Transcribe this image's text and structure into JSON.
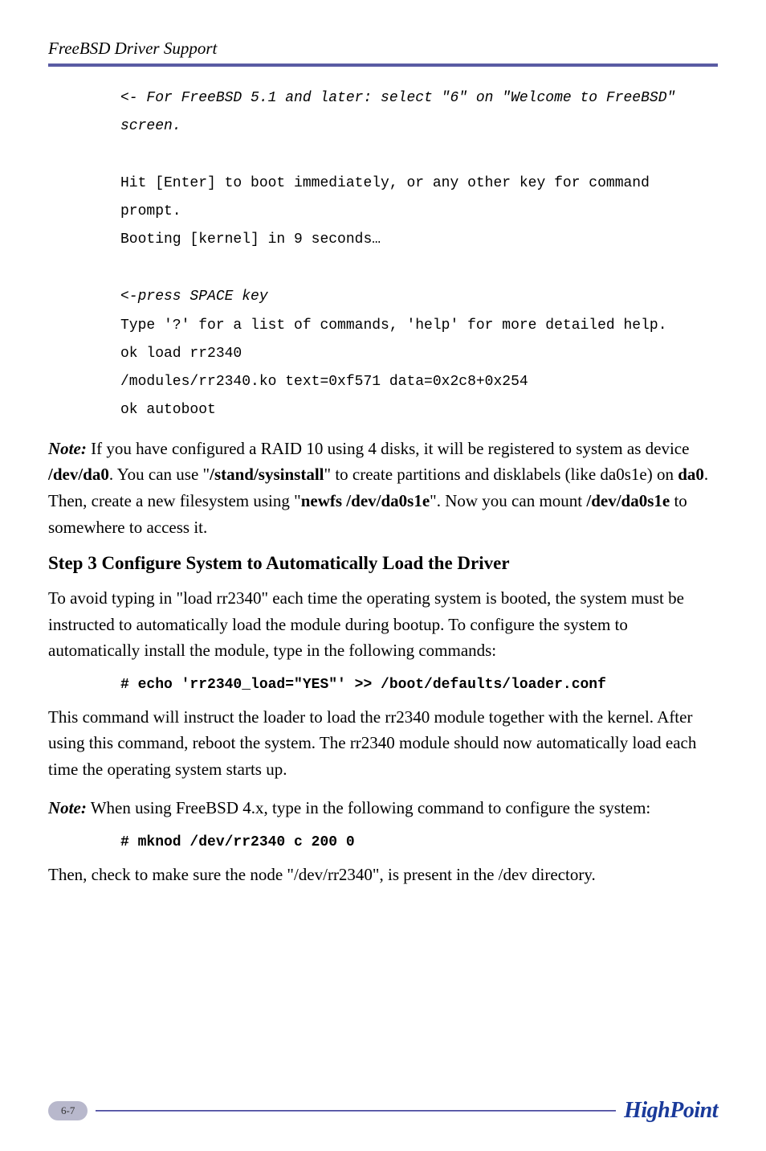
{
  "header": {
    "title": "FreeBSD Driver Support"
  },
  "code1": {
    "line1": "<- For FreeBSD 5.1 and later: select \"6\" on \"Welcome to FreeBSD\" screen.",
    "line2": "Hit [Enter] to boot immediately, or any other key for command prompt.",
    "line3": "Booting [kernel] in 9 seconds…",
    "line4": " <-press SPACE key",
    "line5": "Type '?' for a list of commands, 'help' for more detailed help.",
    "line6": "ok load rr2340",
    "line7": "/modules/rr2340.ko text=0xf571 data=0x2c8+0x254",
    "line8": "ok autoboot"
  },
  "note1": {
    "label": "Note:",
    "part1": " If you have configured a RAID 10 using 4 disks, it will be registered to system as device ",
    "dev1": "/dev/da0",
    "part2": ". You can use \"",
    "cmd1": "/stand/sysinstall",
    "part3": "\" to create partitions and disklabels (like da0s1e) on ",
    "dev2": "da0",
    "part4": ". Then, create a new filesystem using \"",
    "cmd2": "newfs /dev/da0s1e",
    "part5": "\". Now you can mount ",
    "dev3": "/dev/da0s1e",
    "part6": " to somewhere to access it."
  },
  "step3": {
    "heading": "Step 3 Configure System to Automatically Load the Driver",
    "para1": "To avoid typing in \"load rr2340\" each time the operating system is booted, the system must be instructed to automatically load the module during bootup.  To configure the system to automatically install the module, type in the following commands:",
    "cmd1": "# echo 'rr2340_load=\"YES\"' >> /boot/defaults/loader.conf",
    "para2": "This command will instruct the loader to load the rr2340 module together with the kernel.   After using this command, reboot the system.  The rr2340 module should now automatically load each time the operating system starts up."
  },
  "note2": {
    "label": "Note:",
    "text": " When using FreeBSD 4.x, type in the following command to configure the system:",
    "cmd": "# mknod  /dev/rr2340  c  200  0",
    "para": "Then, check to make sure the node \"/dev/rr2340\", is present in the /dev directory."
  },
  "footer": {
    "page": "6-7",
    "logo": "HighPoint"
  }
}
